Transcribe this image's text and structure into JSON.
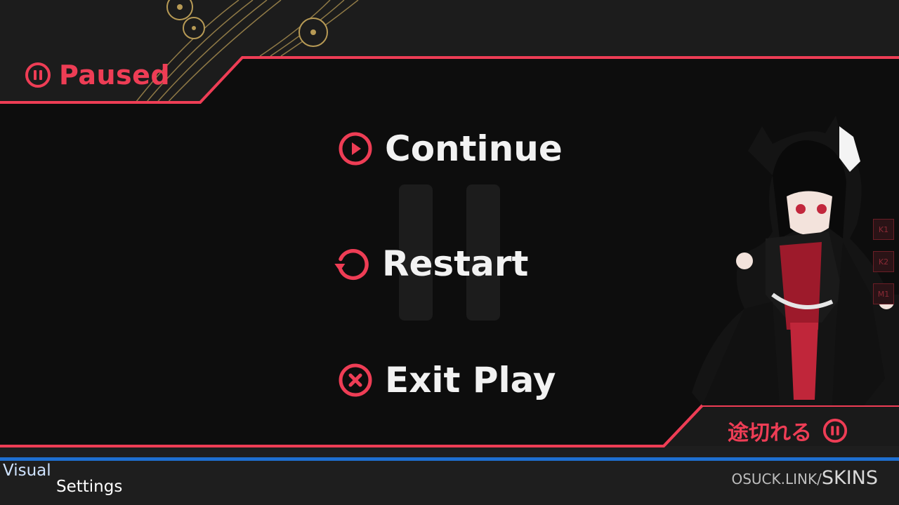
{
  "header": {
    "paused_label": "Paused"
  },
  "menu": {
    "continue_label": "Continue",
    "restart_label": "Restart",
    "exit_label": "Exit Play"
  },
  "corner": {
    "japanese_label": "途切れる"
  },
  "footer": {
    "visual_line1": "Visual",
    "visual_line2": "Settings",
    "skins_prefix": "OSUCK.LINK/",
    "skins_suffix": "SKINS"
  },
  "keys": [
    "K1",
    "K2",
    "M1"
  ],
  "colors": {
    "accent": "#ee3d55",
    "panel": "#0d0d0d",
    "background": "#1a1a1a",
    "footer_line": "#1e6fd0",
    "gold": "#b79a55"
  },
  "icons": {
    "paused": "pause-circle-icon",
    "continue": "play-circle-icon",
    "restart": "restart-arrow-icon",
    "exit": "x-circle-icon",
    "corner": "pause-circle-icon"
  }
}
